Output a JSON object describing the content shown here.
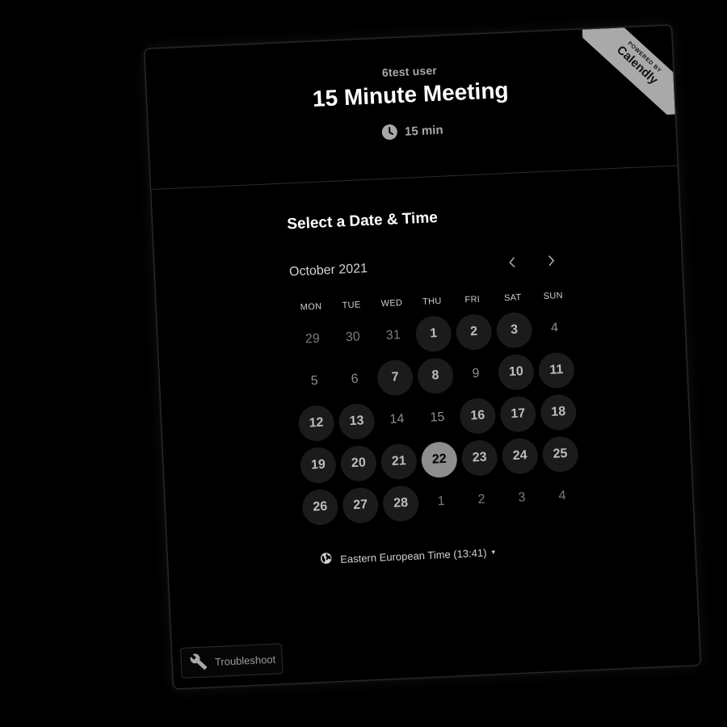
{
  "header": {
    "organizer": "6test user",
    "event_title": "15 Minute Meeting",
    "duration": "15 min",
    "duration_icon": "clock-icon"
  },
  "badge": {
    "small_text": "POWERED BY",
    "brand": "Calendly"
  },
  "picker": {
    "section_title": "Select a Date & Time",
    "month_label": "October 2021",
    "prev_icon": "chevron-left-icon",
    "next_icon": "chevron-right-icon",
    "weekdays": [
      "MON",
      "TUE",
      "WED",
      "THU",
      "FRI",
      "SAT",
      "SUN"
    ],
    "days": [
      {
        "label": "29",
        "state": "other"
      },
      {
        "label": "30",
        "state": "other"
      },
      {
        "label": "31",
        "state": "other"
      },
      {
        "label": "1",
        "state": "available"
      },
      {
        "label": "2",
        "state": "available"
      },
      {
        "label": "3",
        "state": "available"
      },
      {
        "label": "4",
        "state": "unavailable"
      },
      {
        "label": "5",
        "state": "unavailable"
      },
      {
        "label": "6",
        "state": "unavailable"
      },
      {
        "label": "7",
        "state": "available"
      },
      {
        "label": "8",
        "state": "available"
      },
      {
        "label": "9",
        "state": "unavailable"
      },
      {
        "label": "10",
        "state": "available"
      },
      {
        "label": "11",
        "state": "available"
      },
      {
        "label": "12",
        "state": "available"
      },
      {
        "label": "13",
        "state": "available"
      },
      {
        "label": "14",
        "state": "unavailable"
      },
      {
        "label": "15",
        "state": "unavailable"
      },
      {
        "label": "16",
        "state": "available"
      },
      {
        "label": "17",
        "state": "available"
      },
      {
        "label": "18",
        "state": "available"
      },
      {
        "label": "19",
        "state": "available"
      },
      {
        "label": "20",
        "state": "available"
      },
      {
        "label": "21",
        "state": "available"
      },
      {
        "label": "22",
        "state": "selected"
      },
      {
        "label": "23",
        "state": "available"
      },
      {
        "label": "24",
        "state": "available"
      },
      {
        "label": "25",
        "state": "available"
      },
      {
        "label": "26",
        "state": "available"
      },
      {
        "label": "27",
        "state": "available"
      },
      {
        "label": "28",
        "state": "available"
      },
      {
        "label": "1",
        "state": "other"
      },
      {
        "label": "2",
        "state": "other"
      },
      {
        "label": "3",
        "state": "other"
      },
      {
        "label": "4",
        "state": "other"
      }
    ],
    "timezone_label": "Eastern European Time (13:41)",
    "timezone_icon": "globe-icon",
    "timezone_caret": "▾"
  },
  "footer": {
    "troubleshoot_label": "Troubleshoot",
    "troubleshoot_icon": "wrench-icon"
  }
}
